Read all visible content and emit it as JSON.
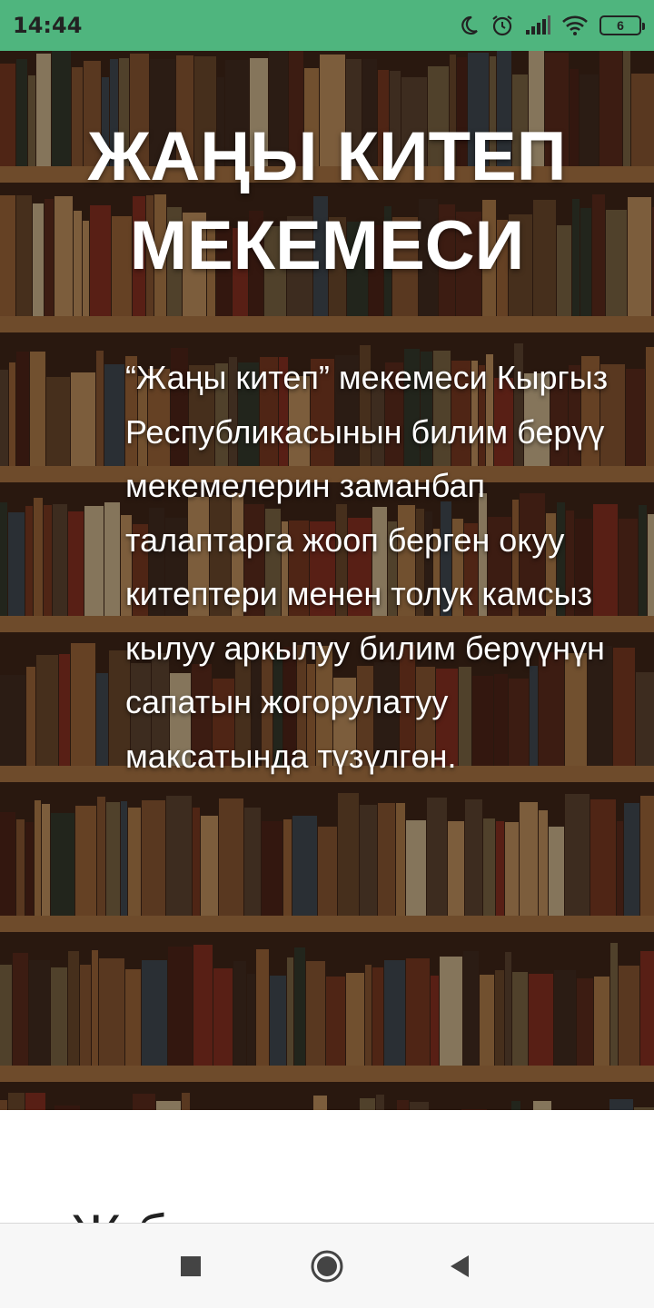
{
  "status_bar": {
    "time": "14:44",
    "battery": "6",
    "icons": [
      "moon-icon",
      "alarm-icon",
      "signal-icon",
      "wifi-icon",
      "battery-icon"
    ]
  },
  "hero": {
    "title_line1": "ЖАҢЫ КИТЕП",
    "title_line2": "МЕКЕМЕСИ",
    "description": "“Жаңы китеп” мекемеси Кыргыз Республикасынын билим берүү мекемелерин заманбап талаптарга жооп берген окуу китептери менен толук камсыз кылуу аркылуу билим берүүнүн сапатын жогорулатуу максатында түзүлгөн.",
    "background_image": "bookshelf-image"
  },
  "section": {
    "heading_partial": "Ж                б"
  },
  "nav_bar": {
    "buttons": [
      "recents-button",
      "home-button",
      "back-button"
    ]
  },
  "colors": {
    "status_bar": "#4fb57e",
    "title": "#ffffff"
  }
}
